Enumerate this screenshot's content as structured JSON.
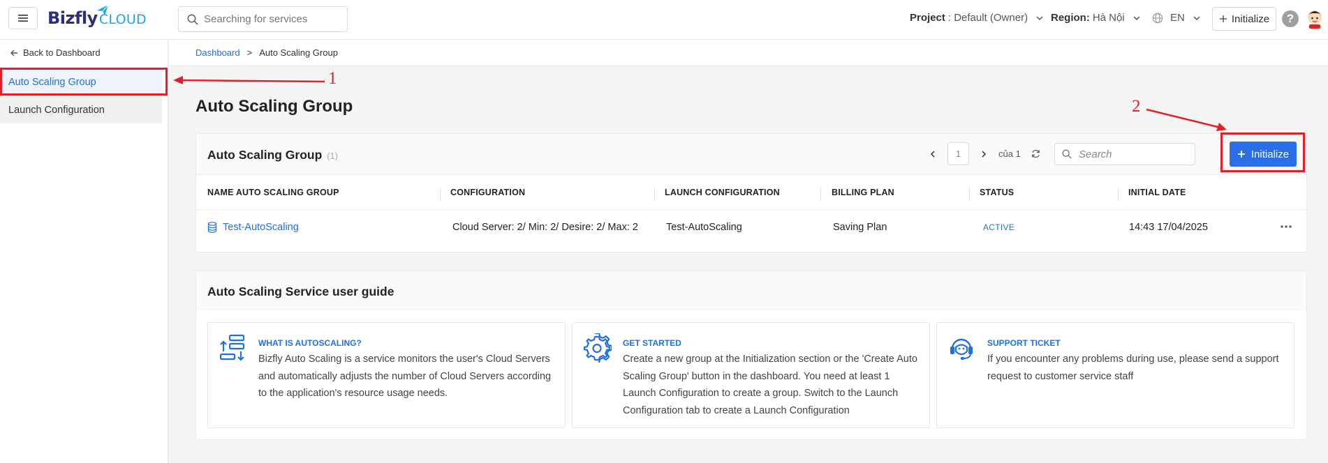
{
  "topbar": {
    "logo_main": "Bizfly",
    "logo_sub": "CLOUD",
    "search_placeholder": "Searching for services",
    "project_label": "Project",
    "project_value": ": Default (Owner)",
    "region_label": "Region:",
    "region_value": "Hà Nội",
    "language": "EN",
    "initialize_label": "Initialize",
    "help": "?"
  },
  "sidebar": {
    "back_label": "Back to Dashboard",
    "items": [
      {
        "label": "Auto Scaling Group"
      },
      {
        "label": "Launch Configuration"
      }
    ]
  },
  "breadcrumb": {
    "home": "Dashboard",
    "separator": ">",
    "current": "Auto Scaling Group"
  },
  "page": {
    "title": "Auto Scaling Group"
  },
  "group_card": {
    "title": "Auto Scaling Group",
    "count": "(1)",
    "page_number": "1",
    "page_total": "của 1",
    "search_placeholder": "Search",
    "initialize_label": "Initialize",
    "columns": [
      "NAME AUTO SCALING GROUP",
      "CONFIGURATION",
      "LAUNCH CONFIGURATION",
      "BILLING PLAN",
      "STATUS",
      "INITIAL DATE"
    ],
    "rows": [
      {
        "name": "Test-AutoScaling",
        "configuration": "Cloud Server: 2/ Min: 2/ Desire: 2/ Max: 2",
        "launch_configuration": "Test-AutoScaling",
        "billing_plan": "Saving Plan",
        "status": "ACTIVE",
        "initial_date": "14:43 17/04/2025"
      }
    ]
  },
  "guide": {
    "title": "Auto Scaling Service user guide",
    "cards": [
      {
        "icon": "autoscaling-icon",
        "title": "WHAT IS AUTOSCALING?",
        "text": "Bizfly Auto Scaling is a service monitors the user's Cloud Servers and automatically adjusts the number of Cloud Servers according to the application's resource usage needs."
      },
      {
        "icon": "gear-icon",
        "title": "GET STARTED",
        "text": "Create a new group at the Initialization section or the 'Create Auto Scaling Group' button in the dashboard. You need at least 1 Launch Configuration to create a group. Switch to the Launch Configuration tab to create a Launch Configuration"
      },
      {
        "icon": "support-agent-icon",
        "title": "SUPPORT TICKET",
        "text": "If you encounter any problems during use, please send a support request to customer service staff"
      }
    ]
  },
  "annotations": {
    "label_1": "1",
    "label_2": "2",
    "color": "#e0202a"
  },
  "colors": {
    "accent": "#2b6fe8",
    "link": "#1e6fe8",
    "annotation": "#e0202a"
  }
}
